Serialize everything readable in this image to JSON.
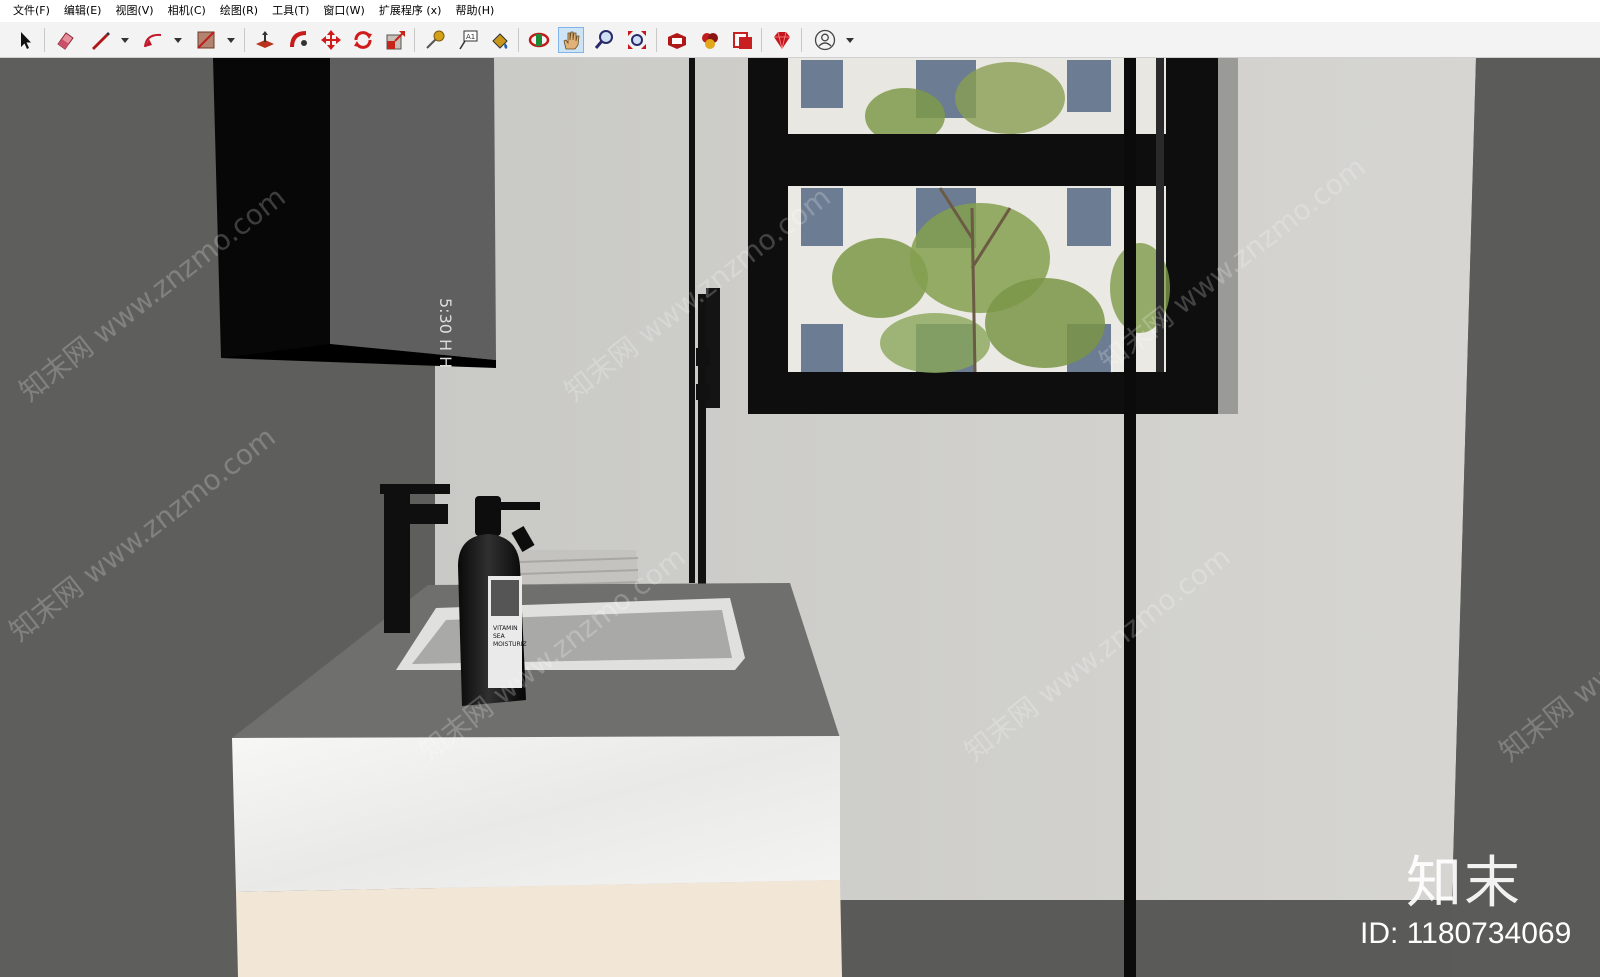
{
  "menu": {
    "items": [
      "文件(F)",
      "编辑(E)",
      "视图(V)",
      "相机(C)",
      "绘图(R)",
      "工具(T)",
      "窗口(W)",
      "扩展程序 (x)",
      "帮助(H)"
    ]
  },
  "toolbar": {
    "tools": [
      {
        "name": "select-tool-icon",
        "color": "#111111"
      },
      {
        "name": "eraser-tool-icon",
        "color": "#e26a7a"
      },
      {
        "name": "line-tool-icon",
        "color": "#b01818"
      },
      {
        "name": "arc-tool-icon",
        "color": "#c0182b"
      },
      {
        "name": "shape-tool-icon",
        "color": "#8a4c3c"
      },
      {
        "name": "push-pull-tool-icon",
        "color": "#b8321e"
      },
      {
        "name": "follow-me-tool-icon",
        "color": "#c61c1c"
      },
      {
        "name": "move-tool-icon",
        "color": "#d11a1a"
      },
      {
        "name": "rotate-tool-icon",
        "color": "#d11a1a"
      },
      {
        "name": "scale-tool-icon",
        "color": "#c8251a"
      },
      {
        "name": "tape-measure-tool-icon",
        "color": "#d4a01a"
      },
      {
        "name": "text-tool-icon",
        "color": "#333333"
      },
      {
        "name": "paint-bucket-tool-icon",
        "color": "#c9961b"
      },
      {
        "name": "orbit-tool-icon",
        "color": "#1d8a3a"
      },
      {
        "name": "pan-tool-icon",
        "color": "#e0b27a"
      },
      {
        "name": "zoom-tool-icon",
        "color": "#2a2a6a"
      },
      {
        "name": "zoom-extents-tool-icon",
        "color": "#c21a1a"
      },
      {
        "name": "3d-warehouse-icon",
        "color": "#b01818"
      },
      {
        "name": "extension-warehouse-icon",
        "color": "#c01d1d"
      },
      {
        "name": "layout-send-icon",
        "color": "#c82020"
      },
      {
        "name": "ruby-console-icon",
        "color": "#c4141e"
      },
      {
        "name": "account-icon",
        "color": "#444444"
      }
    ]
  },
  "watermark": {
    "text": "知末网 www.znzmo.com",
    "logo": "知末",
    "id_label": "ID: 1180734069"
  },
  "scene": {
    "bottle_label": [
      "VITAMIN",
      "SEA",
      "MOISTURIZ"
    ],
    "mirror_text": "5:30 H H"
  }
}
